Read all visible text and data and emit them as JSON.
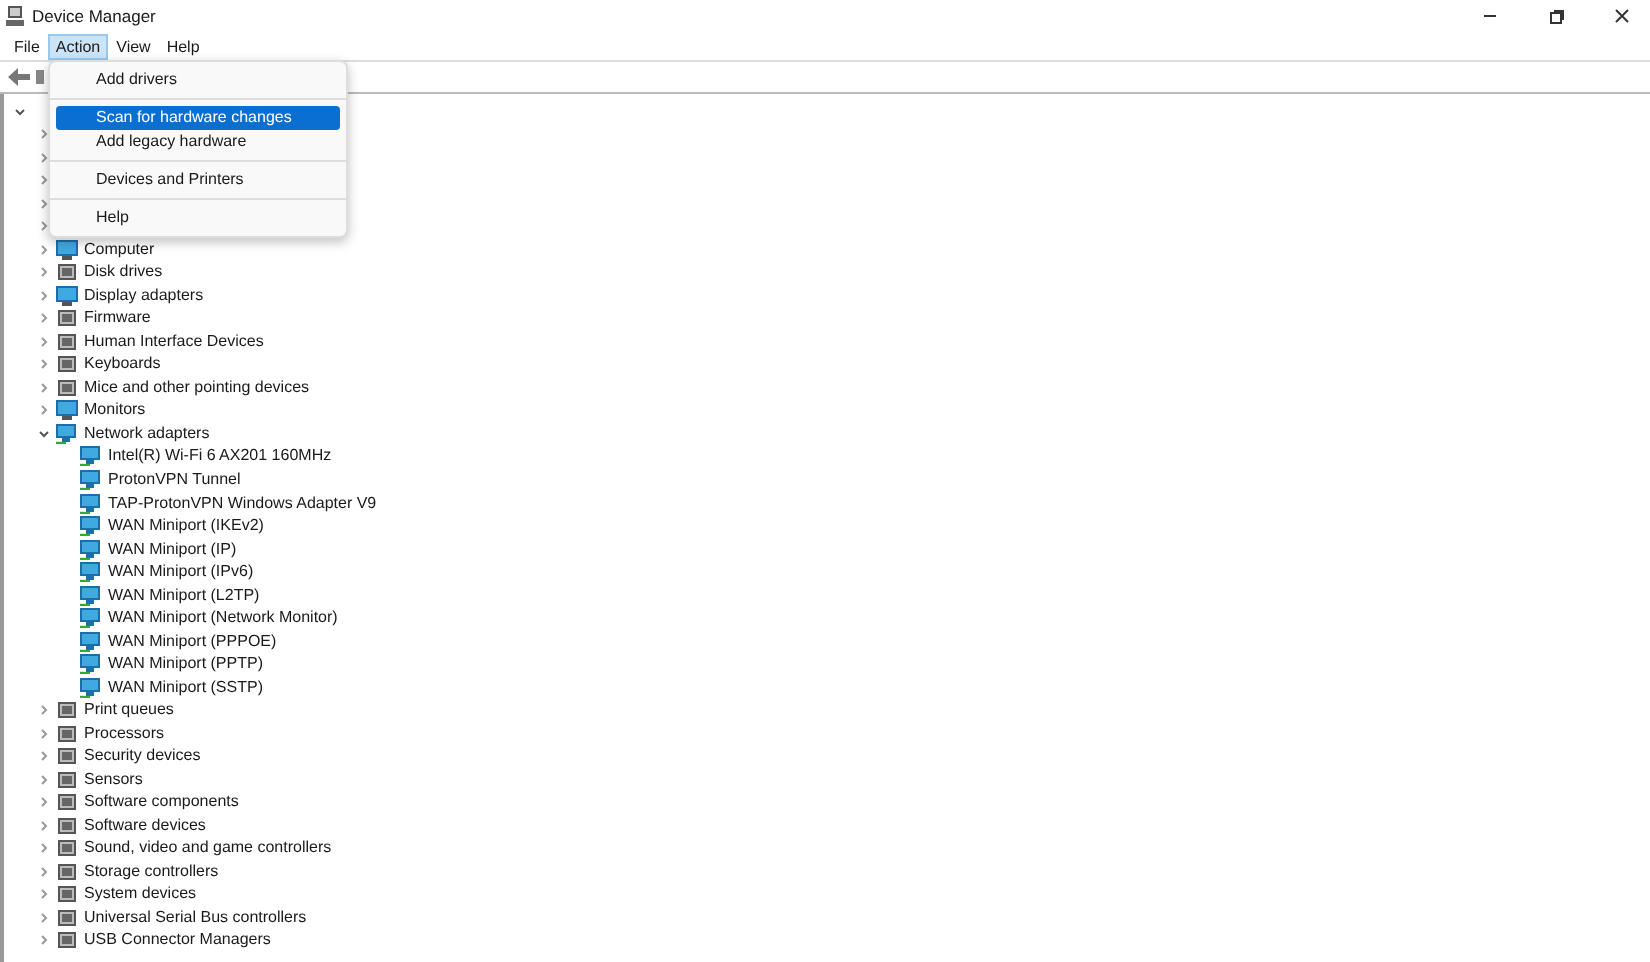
{
  "window": {
    "title": "Device Manager"
  },
  "menu_bar": [
    {
      "label": "File",
      "selected": false
    },
    {
      "label": "Action",
      "selected": true
    },
    {
      "label": "View",
      "selected": false
    },
    {
      "label": "Help",
      "selected": false
    }
  ],
  "action_menu": [
    {
      "label": "Add drivers",
      "selected": false
    },
    {
      "label": "Scan for hardware changes",
      "selected": true
    },
    {
      "label": "Add legacy hardware",
      "selected": false
    },
    {
      "label": "Devices and Printers",
      "selected": false
    },
    {
      "label": "Help",
      "selected": false
    }
  ],
  "tree": [
    {
      "expanded": true,
      "children": [
        {
          "expanded": false
        },
        {
          "expanded": false
        },
        {
          "expanded": false
        },
        {
          "expanded": false
        },
        {
          "expanded": false
        },
        {
          "label": "Computer",
          "expanded": false
        },
        {
          "label": "Disk drives",
          "expanded": false
        },
        {
          "label": "Display adapters",
          "expanded": false
        },
        {
          "label": "Firmware",
          "expanded": false
        },
        {
          "label": "Human Interface Devices",
          "expanded": false
        },
        {
          "label": "Keyboards",
          "expanded": false
        },
        {
          "label": "Mice and other pointing devices",
          "expanded": false
        },
        {
          "label": "Monitors",
          "expanded": false
        },
        {
          "label": "Network adapters",
          "expanded": true,
          "children": [
            {
              "label": "Intel(R) Wi-Fi 6 AX201 160MHz"
            },
            {
              "label": "ProtonVPN Tunnel"
            },
            {
              "label": "TAP-ProtonVPN Windows Adapter V9"
            },
            {
              "label": "WAN Miniport (IKEv2)"
            },
            {
              "label": "WAN Miniport (IP)"
            },
            {
              "label": "WAN Miniport (IPv6)"
            },
            {
              "label": "WAN Miniport (L2TP)"
            },
            {
              "label": "WAN Miniport (Network Monitor)"
            },
            {
              "label": "WAN Miniport (PPPOE)"
            },
            {
              "label": "WAN Miniport (PPTP)"
            },
            {
              "label": "WAN Miniport (SSTP)"
            }
          ]
        },
        {
          "label": "Print queues",
          "expanded": false
        },
        {
          "label": "Processors",
          "expanded": false
        },
        {
          "label": "Security devices",
          "expanded": false
        },
        {
          "label": "Sensors",
          "expanded": false
        },
        {
          "label": "Software components",
          "expanded": false
        },
        {
          "label": "Software devices",
          "expanded": false
        },
        {
          "label": "Sound, video and game controllers",
          "expanded": false
        },
        {
          "label": "Storage controllers",
          "expanded": false
        },
        {
          "label": "System devices",
          "expanded": false
        },
        {
          "label": "Universal Serial Bus controllers",
          "expanded": false
        },
        {
          "label": "USB Connector Managers",
          "expanded": false
        }
      ]
    }
  ]
}
